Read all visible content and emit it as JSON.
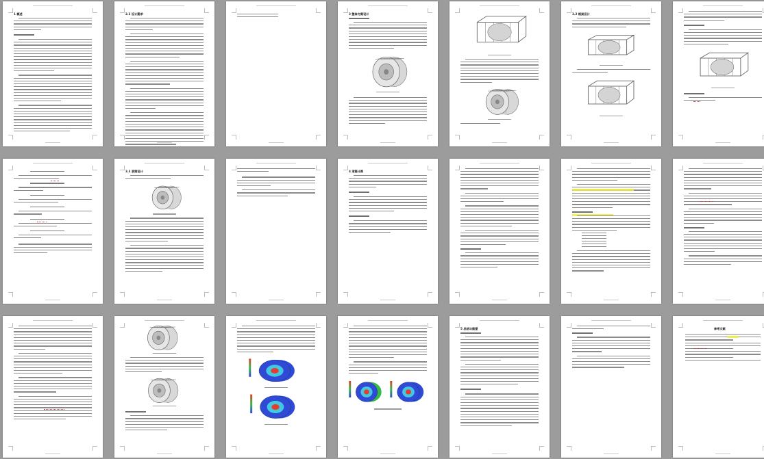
{
  "document": {
    "pages": [
      {
        "heading": "1 概述"
      },
      {
        "heading": "2.2 设计要求"
      },
      {
        "heading": ""
      },
      {
        "heading": "3 整体方案设计"
      },
      {
        "heading": ""
      },
      {
        "heading": "3.2 框架设计"
      },
      {
        "heading": ""
      },
      {
        "heading": ""
      },
      {
        "heading": "3.3 滚筒设计"
      },
      {
        "heading": ""
      },
      {
        "heading": "4 滚筒计算"
      },
      {
        "heading": ""
      },
      {
        "heading": ""
      },
      {
        "heading": ""
      },
      {
        "heading": ""
      },
      {
        "heading": ""
      },
      {
        "heading": ""
      },
      {
        "heading": ""
      },
      {
        "heading": "5 总结与展望"
      },
      {
        "heading": ""
      },
      {
        "heading": "参考文献"
      }
    ]
  },
  "colors": {
    "background": "#9c9c9c",
    "page": "#ffffff",
    "text": "#8a8a8a",
    "highlight": "#f2ef3a",
    "spellcheck": "#d23b3b",
    "fea_blue": "#2f4bd6",
    "fea_red": "#e33d2b",
    "fea_green": "#39b84a"
  }
}
